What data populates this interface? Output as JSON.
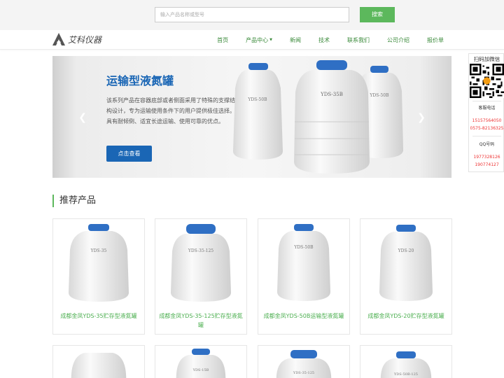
{
  "search": {
    "placeholder": "输入产品名称或型号",
    "button_label": "搜索"
  },
  "logo": {
    "text": "艾科仪器"
  },
  "nav": {
    "items": [
      {
        "label": "首页"
      },
      {
        "label": "产品中心"
      },
      {
        "label": "新闻"
      },
      {
        "label": "技术"
      },
      {
        "label": "联系我们"
      },
      {
        "label": "公司介绍"
      },
      {
        "label": "报价单"
      }
    ]
  },
  "banner": {
    "title": "运输型液氮罐",
    "description": "该系列产品在容器底部或者侧面采用了特殊的支撑结构设计，专为运输使用条件下的用户提供极佳选择。具有耐倾倒、适宜长途运输、使用可靠的优点。",
    "button_label": "点击查看",
    "tank_labels": [
      "YDS-50B",
      "YDS-35B",
      "YDS-50B"
    ]
  },
  "section": {
    "title": "推荐产品"
  },
  "products": [
    {
      "name": "成都金凤YDS-35贮存型液氮罐",
      "tank_label": "YDS-35"
    },
    {
      "name": "成都金凤YDS-35-125贮存型液氮罐",
      "tank_label": "YDS-35-125"
    },
    {
      "name": "成都金凤YDS-50B运输型液氮罐",
      "tank_label": "YDS-50B"
    },
    {
      "name": "成都金凤YDS-20贮存型液氮罐",
      "tank_label": "YDS-20"
    }
  ],
  "products_row2": [
    {
      "tank_label": ""
    },
    {
      "tank_label": "YDS-15B"
    },
    {
      "tank_label": "YDS-35-125"
    },
    {
      "tank_label": "YDS-50B-125"
    }
  ],
  "sidebar": {
    "title": "扫码加微信",
    "service_label": "客服电话",
    "phones": [
      "15157564050",
      "0575-82136325"
    ],
    "qq_label": "QQ号码",
    "qq_numbers": [
      "1977328126",
      "190774127"
    ]
  },
  "colors": {
    "accent_green": "#5cb85c",
    "banner_blue": "#1a66b5",
    "nav_green": "#3a8a3a",
    "phone_red": "#e33333"
  }
}
